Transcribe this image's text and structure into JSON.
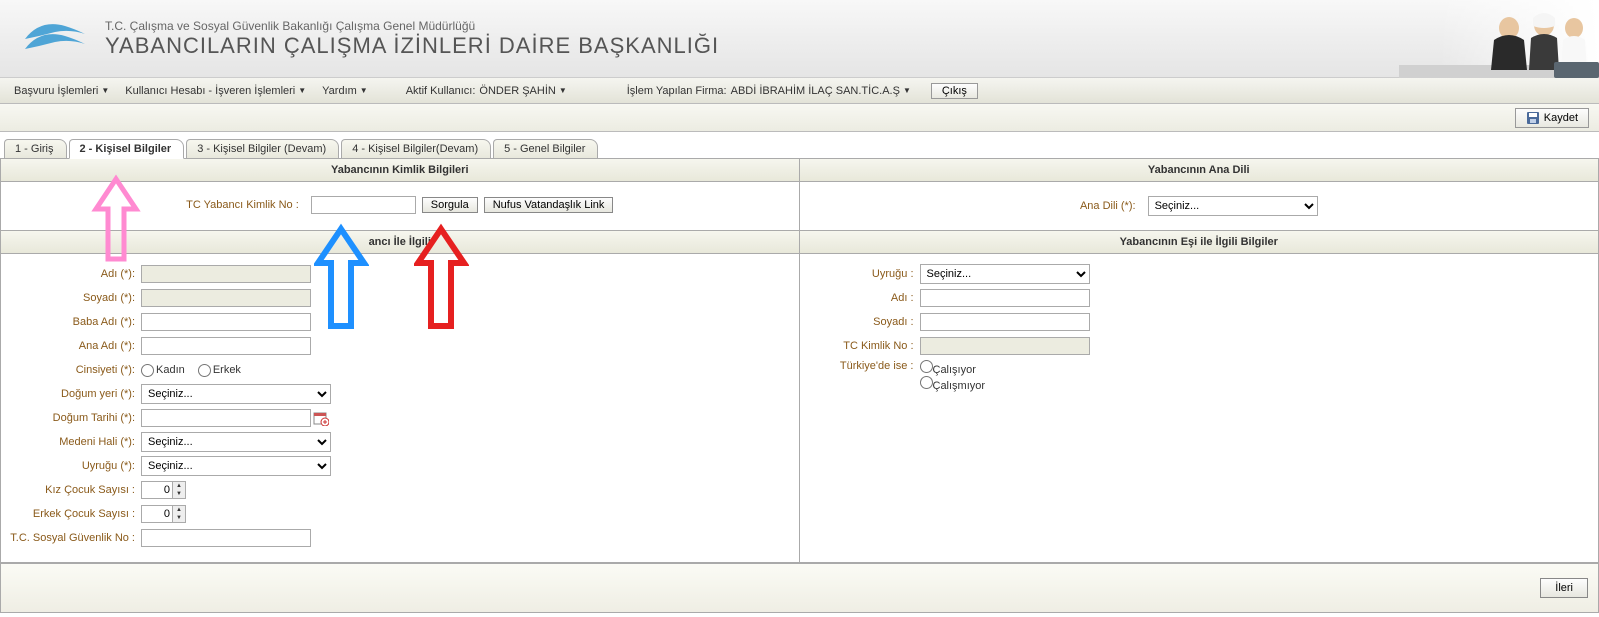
{
  "header": {
    "subtitle": "T.C. Çalışma ve Sosyal Güvenlik Bakanlığı Çalışma Genel Müdürlüğü",
    "title": "YABANCILARIN ÇALIŞMA İZİNLERİ DAİRE BAŞKANLIĞI"
  },
  "menubar": {
    "items": [
      "Başvuru İşlemleri",
      "Kullanıcı Hesabı - İşveren İşlemleri",
      "Yardım"
    ],
    "active_user_label": "Aktif Kullanıcı:",
    "active_user_value": "ÖNDER ŞAHİN",
    "company_label": "İşlem Yapılan Firma:",
    "company_value": "ABDİ İBRAHİM İLAÇ SAN.TİC.A.Ş",
    "exit": "Çıkış"
  },
  "savebar": {
    "save": "Kaydet"
  },
  "tabs": [
    {
      "label": "1 - Giriş",
      "active": false
    },
    {
      "label": "2 - Kişisel Bilgiler",
      "active": true
    },
    {
      "label": "3 - Kişisel Bilgiler (Devam)",
      "active": false
    },
    {
      "label": "4 - Kişisel Bilgiler(Devam)",
      "active": false
    },
    {
      "label": "5 - Genel Bilgiler",
      "active": false
    }
  ],
  "sections": {
    "identity": {
      "title": "Yabancının Kimlik Bilgileri",
      "id_label": "TC Yabancı Kimlik No :",
      "query_btn": "Sorgula",
      "link_btn": "Nufus Vatandaşlık Link"
    },
    "language": {
      "title": "Yabancının Ana Dili",
      "label": "Ana Dili (*):",
      "placeholder": "Seçiniz..."
    },
    "foreigner": {
      "title": "ancı İle İlgili",
      "fields": {
        "adi": "Adı (*):",
        "soyadi": "Soyadı (*):",
        "baba": "Baba Adı (*):",
        "ana": "Ana Adı (*):",
        "cinsiyet": "Cinsiyeti (*):",
        "cinsiyet_kadin": "Kadın",
        "cinsiyet_erkek": "Erkek",
        "dogumyeri": "Doğum yeri (*):",
        "dogumyeri_ph": "Seçiniz...",
        "dogumtarihi": "Doğum Tarihi (*):",
        "medeni": "Medeni Hali (*):",
        "medeni_ph": "Seçiniz...",
        "uyruk": "Uyruğu (*):",
        "uyruk_ph": "Seçiniz...",
        "kiz": "Kız Çocuk Sayısı :",
        "kiz_val": "0",
        "erkek": "Erkek Çocuk Sayısı :",
        "erkek_val": "0",
        "sgk": "T.C. Sosyal Güvenlik No :"
      }
    },
    "spouse": {
      "title": "Yabancının Eşi ile İlgili Bilgiler",
      "fields": {
        "uyruk": "Uyruğu :",
        "uyruk_ph": "Seçiniz...",
        "adi": "Adı :",
        "soyadi": "Soyadı :",
        "tc": "TC Kimlik No :",
        "turkiye": "Türkiye'de ise :",
        "calisiyor": "Çalışıyor",
        "calismiyor": "Çalışmıyor"
      }
    }
  },
  "footer": {
    "next": "İleri"
  }
}
